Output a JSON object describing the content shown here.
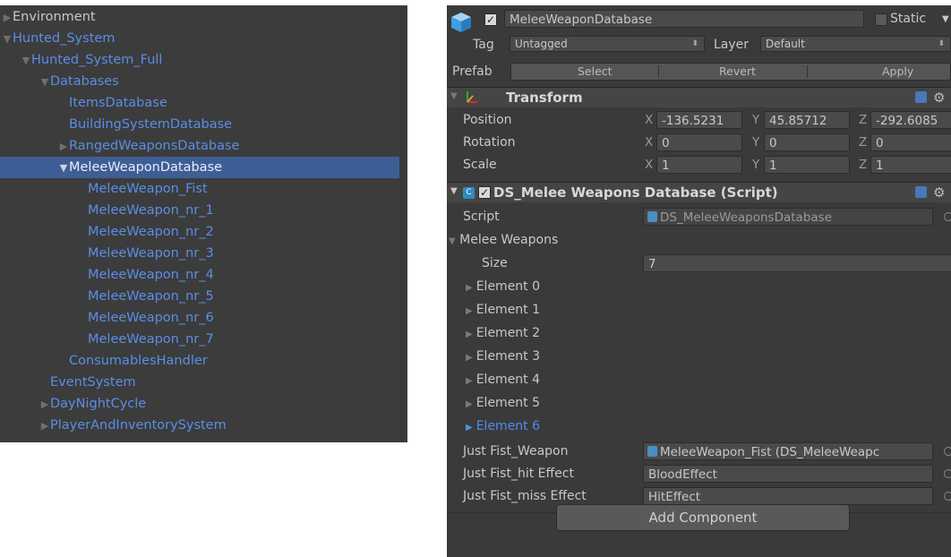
{
  "hierarchy": {
    "rows": [
      {
        "label": "Environment",
        "expanded": false,
        "has_arrow": true,
        "color": "gray",
        "selected": false
      },
      {
        "label": "Hunted_System",
        "expanded": true,
        "has_arrow": true,
        "color": "blue",
        "selected": false
      },
      {
        "label": "Hunted_System_Full",
        "expanded": true,
        "has_arrow": true,
        "color": "blue",
        "selected": false
      },
      {
        "label": "Databases",
        "expanded": true,
        "has_arrow": true,
        "color": "blue",
        "selected": false
      },
      {
        "label": "ItemsDatabase",
        "expanded": false,
        "has_arrow": false,
        "color": "blue",
        "selected": false
      },
      {
        "label": "BuildingSystemDatabase",
        "expanded": false,
        "has_arrow": false,
        "color": "blue",
        "selected": false
      },
      {
        "label": "RangedWeaponsDatabase",
        "expanded": false,
        "has_arrow": true,
        "color": "blue",
        "selected": false
      },
      {
        "label": "MeleeWeaponDatabase",
        "expanded": true,
        "has_arrow": true,
        "color": "white",
        "selected": true
      },
      {
        "label": "MeleeWeapon_Fist",
        "expanded": false,
        "has_arrow": false,
        "color": "blue",
        "selected": false
      },
      {
        "label": "MeleeWeapon_nr_1",
        "expanded": false,
        "has_arrow": false,
        "color": "blue",
        "selected": false
      },
      {
        "label": "MeleeWeapon_nr_2",
        "expanded": false,
        "has_arrow": false,
        "color": "blue",
        "selected": false
      },
      {
        "label": "MeleeWeapon_nr_3",
        "expanded": false,
        "has_arrow": false,
        "color": "blue",
        "selected": false
      },
      {
        "label": "MeleeWeapon_nr_4",
        "expanded": false,
        "has_arrow": false,
        "color": "blue",
        "selected": false
      },
      {
        "label": "MeleeWeapon_nr_5",
        "expanded": false,
        "has_arrow": false,
        "color": "blue",
        "selected": false
      },
      {
        "label": "MeleeWeapon_nr_6",
        "expanded": false,
        "has_arrow": false,
        "color": "blue",
        "selected": false
      },
      {
        "label": "MeleeWeapon_nr_7",
        "expanded": false,
        "has_arrow": false,
        "color": "blue",
        "selected": false
      },
      {
        "label": "ConsumablesHandler",
        "expanded": false,
        "has_arrow": false,
        "color": "blue",
        "selected": false
      },
      {
        "label": "EventSystem",
        "expanded": false,
        "has_arrow": false,
        "color": "blue",
        "selected": false
      },
      {
        "label": "DayNightCycle",
        "expanded": false,
        "has_arrow": true,
        "color": "blue",
        "selected": false
      },
      {
        "label": "PlayerAndInventorySystem",
        "expanded": false,
        "has_arrow": true,
        "color": "blue",
        "selected": false
      }
    ]
  },
  "inspector": {
    "object_active_check": "✓",
    "object_name": "MeleeWeaponDatabase",
    "static_label": "Static",
    "tag_label": "Tag",
    "tag_value": "Untagged",
    "layer_label": "Layer",
    "layer_value": "Default",
    "prefab_label": "Prefab",
    "prefab_buttons": {
      "select": "Select",
      "revert": "Revert",
      "apply": "Apply"
    },
    "transform": {
      "title": "Transform",
      "position_label": "Position",
      "rotation_label": "Rotation",
      "scale_label": "Scale",
      "axis_x": "X",
      "axis_y": "Y",
      "axis_z": "Z",
      "position": {
        "x": "-136.5231",
        "y": "45.85712",
        "z": "-292.6085"
      },
      "rotation": {
        "x": "0",
        "y": "0",
        "z": "0"
      },
      "scale": {
        "x": "1",
        "y": "1",
        "z": "1"
      }
    },
    "script_component": {
      "title": "DS_Melee Weapons Database (Script)",
      "enabled_check": "✓",
      "script_label": "Script",
      "script_value": "DS_MeleeWeaponsDatabase",
      "melee_weapons_label": "Melee Weapons",
      "size_label": "Size",
      "size_value": "7",
      "elements": [
        "Element 0",
        "Element 1",
        "Element 2",
        "Element 3",
        "Element 4",
        "Element 5",
        "Element 6"
      ],
      "active_element_index": 6,
      "just_fist_weapon_label": "Just Fist_Weapon",
      "just_fist_weapon_value": "MeleeWeapon_Fist (DS_MeleeWeapc",
      "just_fist_hit_label": "Just Fist_hit Effect",
      "just_fist_hit_value": "BloodEffect",
      "just_fist_miss_label": "Just Fist_miss Effect",
      "just_fist_miss_value": "HitEffect"
    },
    "add_component_label": "Add Component"
  },
  "colors": {
    "panel_bg": "#3c3c3c",
    "selection": "#3e5f96",
    "hierarchy_text_blue": "#5a8ee6",
    "inspector_bg": "#3a3a3a",
    "active_element_blue": "#4f8cf0"
  },
  "icons": {
    "cube": "cube-icon",
    "transform": "transform-axes-icon",
    "script": "csharp-script-icon",
    "help": "help-icon",
    "settings": "gear-icon",
    "object_picker": "object-picker-icon"
  }
}
